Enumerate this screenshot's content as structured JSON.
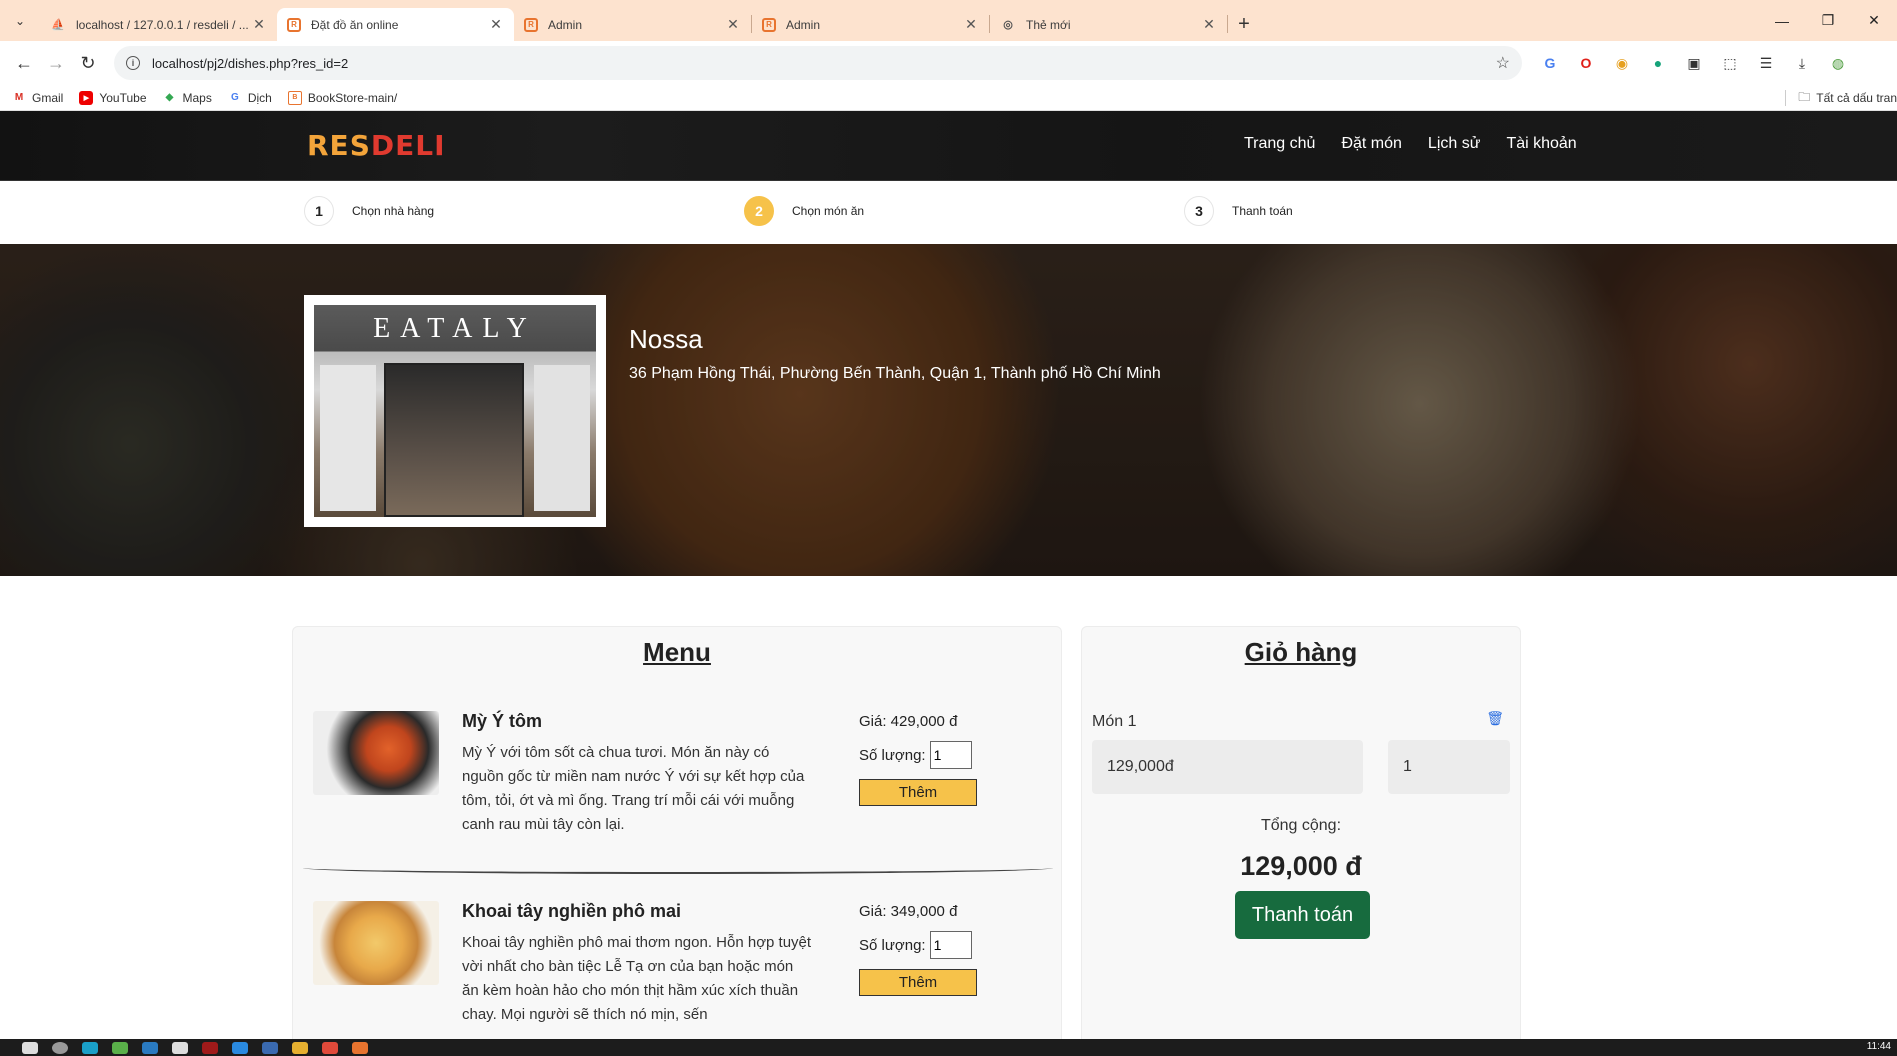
{
  "browser": {
    "tabs": [
      {
        "title": "localhost / 127.0.0.1 / resdeli / ...",
        "icon": "phpmyadmin-icon",
        "active": false
      },
      {
        "title": "Đặt đồ ăn online",
        "icon": "resdeli-icon",
        "active": true
      },
      {
        "title": "Admin",
        "icon": "resdeli-icon",
        "active": false
      },
      {
        "title": "Admin",
        "icon": "resdeli-icon",
        "active": false
      },
      {
        "title": "Thẻ mới",
        "icon": "chrome-icon",
        "active": false
      }
    ],
    "url": "localhost/pj2/dishes.php?res_id=2",
    "bookmarks": [
      {
        "label": "Gmail",
        "icon": "gmail-icon"
      },
      {
        "label": "YouTube",
        "icon": "youtube-icon"
      },
      {
        "label": "Maps",
        "icon": "maps-icon"
      },
      {
        "label": "Dịch",
        "icon": "translate-icon"
      },
      {
        "label": "BookStore-main/",
        "icon": "bookstore-icon"
      }
    ],
    "all_bookmarks_label": "Tất cả dấu tran"
  },
  "site": {
    "logo_res": "RES",
    "logo_deli": "DELI",
    "nav": [
      "Trang chủ",
      "Đặt món",
      "Lịch sử",
      "Tài khoản"
    ]
  },
  "steps": [
    {
      "num": "1",
      "label": "Chọn nhà hàng",
      "active": false
    },
    {
      "num": "2",
      "label": "Chọn món ăn",
      "active": true
    },
    {
      "num": "3",
      "label": "Thanh toán",
      "active": false
    }
  ],
  "restaurant": {
    "image_brand": "EATALY",
    "name": "Nossa",
    "address": "36 Phạm Hồng Thái, Phường Bến Thành, Quận 1, Thành phố Hồ Chí Minh"
  },
  "menu": {
    "title": "Menu",
    "price_prefix": "Giá: ",
    "qty_label": "Số lượng:",
    "add_label": "Thêm",
    "dishes": [
      {
        "name": "Mỳ Ý tôm",
        "description": "Mỳ Ý với tôm sốt cà chua tươi. Món ăn này có nguồn gốc từ miền nam nước Ý với sự kết hợp của tôm, tỏi, ớt và mì ống. Trang trí mỗi cái với muỗng canh rau mùi tây còn lại.",
        "price": "Giá: 429,000 đ",
        "qty": "1"
      },
      {
        "name": "Khoai tây nghiền phô mai",
        "description": "Khoai tây nghiền phô mai thơm ngon. Hỗn hợp tuyệt vời nhất cho bàn tiệc Lễ Tạ ơn của bạn hoặc món ăn kèm hoàn hảo cho món thịt hầm xúc xích thuần chay. Mọi người sẽ thích nó mịn, sến",
        "price": "Giá: 349,000 đ",
        "qty": "1"
      }
    ]
  },
  "cart": {
    "title": "Giỏ hàng",
    "item_label": "Món 1",
    "item_price": "129,000đ",
    "item_qty": "1",
    "total_label": "Tổng cộng:",
    "total_value": "129,000 đ",
    "checkout_label": "Thanh toán"
  },
  "taskbar": {
    "clock": "11:44"
  },
  "colors": {
    "accent": "#f6c24a",
    "checkout": "#176b3e",
    "logo_res": "#f3a43a",
    "logo_deli": "#e03a2f"
  }
}
